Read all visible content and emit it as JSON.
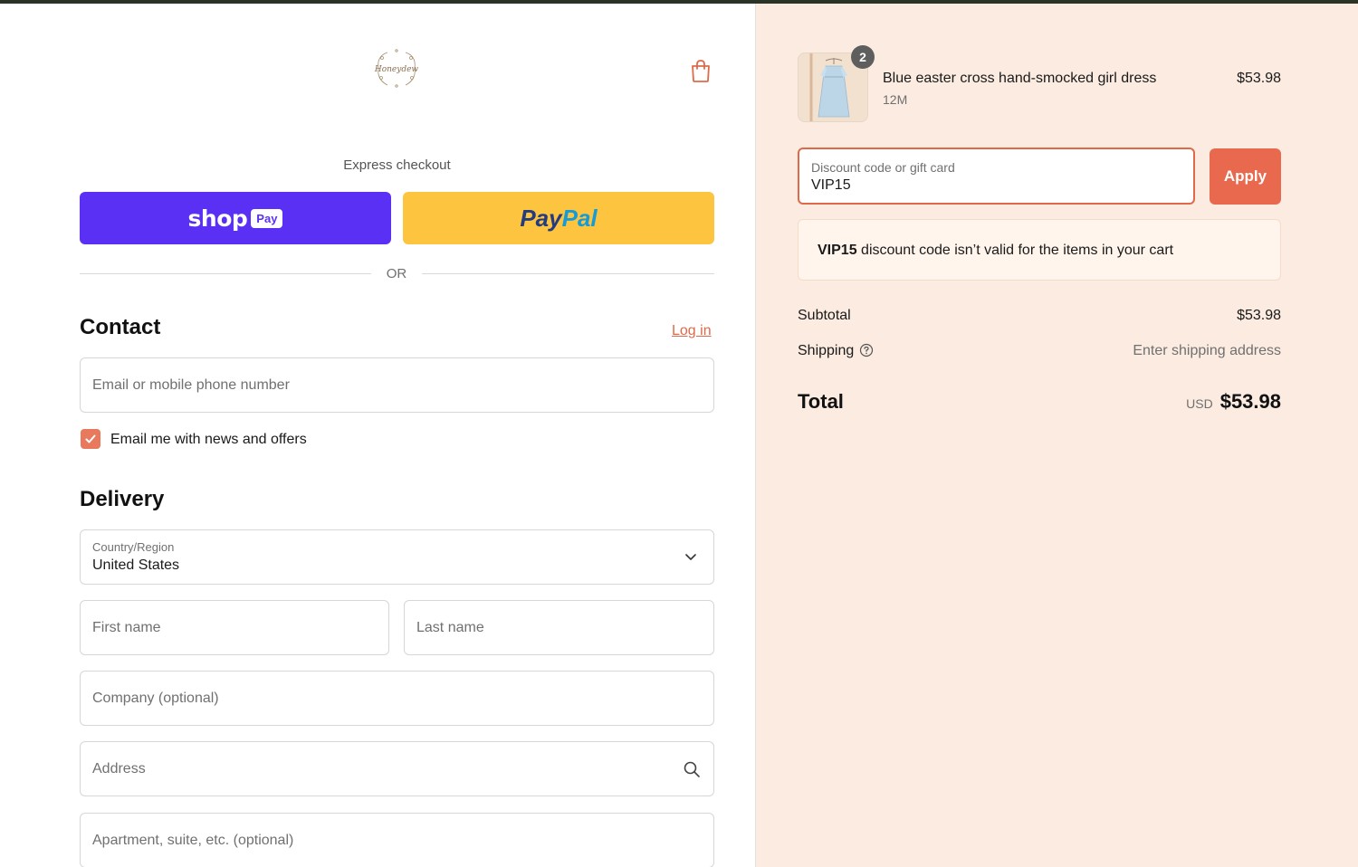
{
  "brand": {
    "logo_text": "Honeydew"
  },
  "express": {
    "label": "Express checkout",
    "shoppay_word": "shop",
    "shoppay_badge": "Pay",
    "paypal_part1": "Pay",
    "paypal_part2": "Pal",
    "or_text": "OR"
  },
  "contact": {
    "heading": "Contact",
    "login_label": "Log in",
    "email_placeholder": "Email or mobile phone number",
    "newsletter_label": "Email me with news and offers",
    "newsletter_checked": true
  },
  "delivery": {
    "heading": "Delivery",
    "country_label": "Country/Region",
    "country_value": "United States",
    "first_name_placeholder": "First name",
    "last_name_placeholder": "Last name",
    "company_placeholder": "Company (optional)",
    "address_placeholder": "Address",
    "apartment_placeholder": "Apartment, suite, etc. (optional)"
  },
  "order": {
    "item": {
      "name": "Blue easter cross hand-smocked girl dress",
      "variant": "12M",
      "price": "$53.98",
      "quantity": "2"
    },
    "discount": {
      "label": "Discount code or gift card",
      "value": "VIP15",
      "apply_label": "Apply"
    },
    "alert": {
      "code": "VIP15",
      "message": " discount code isn’t valid for the items in your cart"
    },
    "subtotal_label": "Subtotal",
    "subtotal_value": "$53.98",
    "shipping_label": "Shipping",
    "shipping_value": "Enter shipping address",
    "total_label": "Total",
    "total_currency": "USD",
    "total_value": "$53.98"
  },
  "colors": {
    "accent": "#e8694e",
    "shoppay": "#5a31f4",
    "paypal": "#fcc43f",
    "summary_bg": "#fbebe0"
  }
}
